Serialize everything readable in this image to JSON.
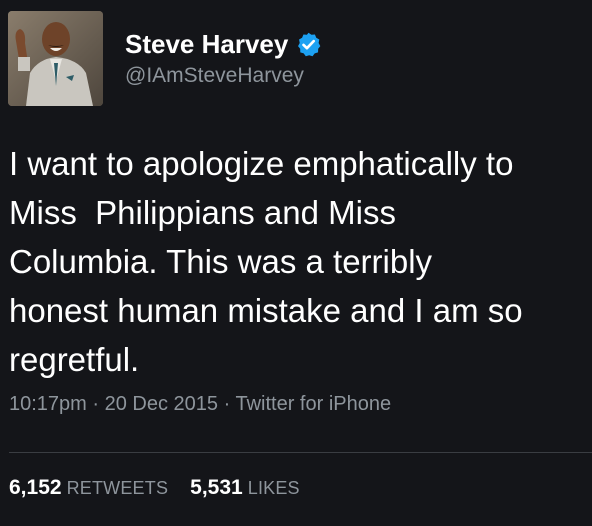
{
  "author": {
    "display_name": "Steve Harvey",
    "handle": "@IAmSteveHarvey",
    "verified_icon": "verified-badge-icon",
    "verified_color": "#1da1f2"
  },
  "tweet": {
    "text": "I want to apologize emphatically to\nMiss  Philippians and Miss\nColumbia. This was a terribly\nhonest human mistake and I am so\nregretful.",
    "time": "10:17pm",
    "date": "20 Dec 2015",
    "source": "Twitter for iPhone",
    "separator": " · "
  },
  "stats": {
    "retweets_count": "6,152",
    "retweets_label": "RETWEETS",
    "likes_count": "5,531",
    "likes_label": "LIKES"
  },
  "colors": {
    "background": "#141519",
    "text_primary": "#ffffff",
    "text_secondary": "#8e959c"
  }
}
